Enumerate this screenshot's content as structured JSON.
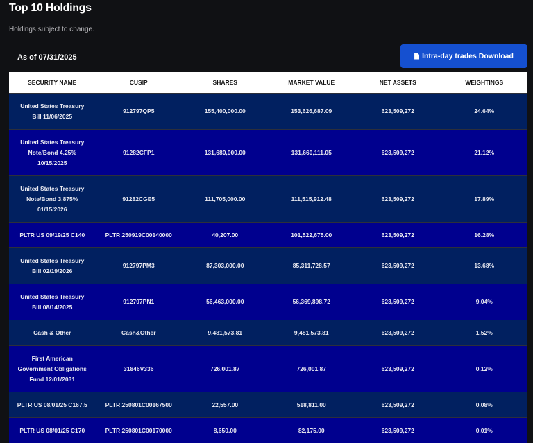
{
  "header": {
    "title": "Top 10 Holdings",
    "subtitle": "Holdings subject to change.",
    "as_of": "As of 07/31/2025",
    "download_label": "Intra-day trades Download",
    "download_icon": "file-download-icon"
  },
  "colors": {
    "row_dark": "#012060",
    "row_blue": "#00008e",
    "button": "#1550d0"
  },
  "table": {
    "columns": [
      "SECURITY NAME",
      "CUSIP",
      "SHARES",
      "MARKET VALUE",
      "NET ASSETS",
      "WEIGHTINGS"
    ],
    "rows": [
      [
        "United States Treasury\nBill 11/06/2025",
        "912797QP5",
        "155,400,000.00",
        "153,626,687.09",
        "623,509,272",
        "24.64%"
      ],
      [
        "United States Treasury\nNote/Bond 4.25%\n10/15/2025",
        "91282CFP1",
        "131,680,000.00",
        "131,660,111.05",
        "623,509,272",
        "21.12%"
      ],
      [
        "United States Treasury\nNote/Bond 3.875%\n01/15/2026",
        "91282CGE5",
        "111,705,000.00",
        "111,515,912.48",
        "623,509,272",
        "17.89%"
      ],
      [
        "PLTR US 09/19/25 C140",
        "PLTR 250919C00140000",
        "40,207.00",
        "101,522,675.00",
        "623,509,272",
        "16.28%"
      ],
      [
        "United States Treasury\nBill 02/19/2026",
        "912797PM3",
        "87,303,000.00",
        "85,311,728.57",
        "623,509,272",
        "13.68%"
      ],
      [
        "United States Treasury\nBill 08/14/2025",
        "912797PN1",
        "56,463,000.00",
        "56,369,898.72",
        "623,509,272",
        "9.04%"
      ],
      [
        "Cash & Other",
        "Cash&Other",
        "9,481,573.81",
        "9,481,573.81",
        "623,509,272",
        "1.52%"
      ],
      [
        "First American\nGovernment Obligations\nFund 12/01/2031",
        "31846V336",
        "726,001.87",
        "726,001.87",
        "623,509,272",
        "0.12%"
      ],
      [
        "PLTR US 08/01/25 C167.5",
        "PLTR 250801C00167500",
        "22,557.00",
        "518,811.00",
        "623,509,272",
        "0.08%"
      ],
      [
        "PLTR US 08/01/25 C170",
        "PLTR 250801C00170000",
        "8,650.00",
        "82,175.00",
        "623,509,272",
        "0.01%"
      ]
    ]
  }
}
